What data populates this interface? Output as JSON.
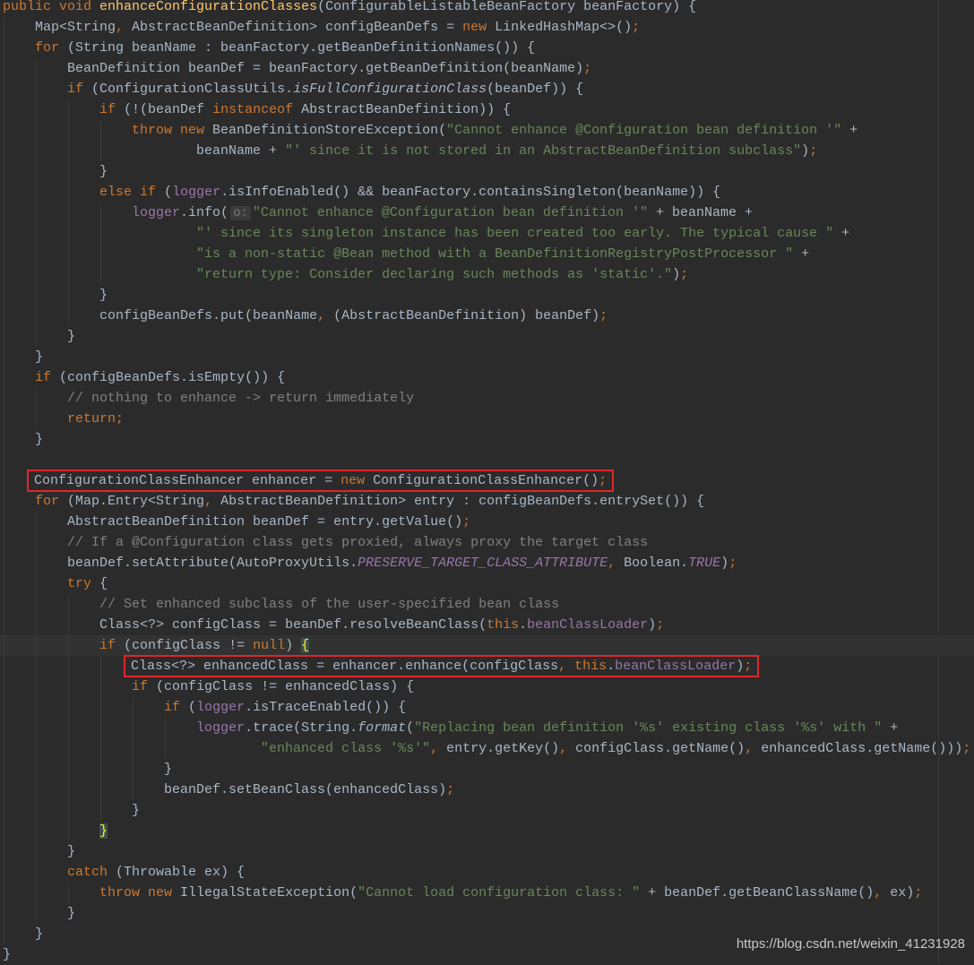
{
  "colors": {
    "background": "#2b2b2b",
    "text": "#a9b7c6",
    "keyword": "#cc7832",
    "string": "#6a8759",
    "comment": "#808080",
    "field": "#9876aa",
    "method_declaration": "#ffc66d",
    "highlight_box": "#e0262a"
  },
  "current_line": 32,
  "watermark": "https://blog.csdn.net/weixin_41231928",
  "lines": [
    {
      "indent": 0,
      "depth": 0,
      "tokens": [
        [
          "k",
          "public void "
        ],
        [
          "m",
          "enhanceConfigurationClasses"
        ],
        [
          "t",
          "(ConfigurableListableBeanFactory beanFactory) {"
        ]
      ]
    },
    {
      "indent": 4,
      "depth": 1,
      "tokens": [
        [
          "t",
          "Map<String, AbstractBeanDefinition> configBeanDefs = "
        ],
        [
          "k",
          "new"
        ],
        [
          "t",
          " LinkedHashMap<>();"
        ]
      ]
    },
    {
      "indent": 4,
      "depth": 1,
      "tokens": [
        [
          "k",
          "for"
        ],
        [
          "t",
          " (String beanName : beanFactory.getBeanDefinitionNames()) {"
        ]
      ]
    },
    {
      "indent": 8,
      "depth": 2,
      "tokens": [
        [
          "t",
          "BeanDefinition beanDef = beanFactory.getBeanDefinition(beanName);"
        ]
      ]
    },
    {
      "indent": 8,
      "depth": 2,
      "tokens": [
        [
          "k",
          "if"
        ],
        [
          "t",
          " (ConfigurationClassUtils."
        ],
        [
          "i",
          "isFullConfigurationClass"
        ],
        [
          "t",
          "(beanDef)) {"
        ]
      ]
    },
    {
      "indent": 12,
      "depth": 3,
      "tokens": [
        [
          "k",
          "if"
        ],
        [
          "t",
          " (!(beanDef "
        ],
        [
          "k",
          "instanceof"
        ],
        [
          "t",
          " AbstractBeanDefinition)) {"
        ]
      ]
    },
    {
      "indent": 16,
      "depth": 4,
      "tokens": [
        [
          "k",
          "throw new"
        ],
        [
          "t",
          " BeanDefinitionStoreException("
        ],
        [
          "s",
          "\"Cannot enhance @Configuration bean definition '\""
        ],
        [
          "t",
          " +"
        ]
      ]
    },
    {
      "indent": 24,
      "depth": 4,
      "tokens": [
        [
          "t",
          "beanName + "
        ],
        [
          "s",
          "\"' since it is not stored in an AbstractBeanDefinition subclass\""
        ],
        [
          "t",
          ");"
        ]
      ]
    },
    {
      "indent": 12,
      "depth": 3,
      "tokens": [
        [
          "t",
          "}"
        ]
      ]
    },
    {
      "indent": 12,
      "depth": 3,
      "tokens": [
        [
          "k",
          "else if"
        ],
        [
          "t",
          " ("
        ],
        [
          "f",
          "logger"
        ],
        [
          "t",
          ".isInfoEnabled() && beanFactory.containsSingleton(beanName)) {"
        ]
      ]
    },
    {
      "indent": 16,
      "depth": 4,
      "tokens": [
        [
          "f",
          "logger"
        ],
        [
          "t",
          ".info("
        ],
        [
          "h",
          "o:"
        ],
        [
          "s",
          "\"Cannot enhance @Configuration bean definition '\""
        ],
        [
          "t",
          " + beanName +"
        ]
      ]
    },
    {
      "indent": 24,
      "depth": 4,
      "tokens": [
        [
          "s",
          "\"' since its singleton instance has been created too early. The typical cause \""
        ],
        [
          "t",
          " +"
        ]
      ]
    },
    {
      "indent": 24,
      "depth": 4,
      "tokens": [
        [
          "s",
          "\"is a non-static @Bean method with a BeanDefinitionRegistryPostProcessor \""
        ],
        [
          "t",
          " +"
        ]
      ]
    },
    {
      "indent": 24,
      "depth": 4,
      "tokens": [
        [
          "s",
          "\"return type: Consider declaring such methods as 'static'.\""
        ],
        [
          "t",
          ");"
        ]
      ]
    },
    {
      "indent": 12,
      "depth": 3,
      "tokens": [
        [
          "t",
          "}"
        ]
      ]
    },
    {
      "indent": 12,
      "depth": 3,
      "tokens": [
        [
          "t",
          "configBeanDefs.put(beanName, (AbstractBeanDefinition) beanDef);"
        ]
      ]
    },
    {
      "indent": 8,
      "depth": 2,
      "tokens": [
        [
          "t",
          "}"
        ]
      ]
    },
    {
      "indent": 4,
      "depth": 1,
      "tokens": [
        [
          "t",
          "}"
        ]
      ]
    },
    {
      "indent": 4,
      "depth": 1,
      "tokens": [
        [
          "k",
          "if"
        ],
        [
          "t",
          " (configBeanDefs.isEmpty()) {"
        ]
      ]
    },
    {
      "indent": 8,
      "depth": 2,
      "tokens": [
        [
          "c",
          "// nothing to enhance -> return immediately"
        ]
      ]
    },
    {
      "indent": 8,
      "depth": 2,
      "tokens": [
        [
          "k",
          "return"
        ],
        [
          "t",
          ";"
        ]
      ]
    },
    {
      "indent": 4,
      "depth": 1,
      "tokens": [
        [
          "t",
          "}"
        ]
      ]
    },
    {
      "indent": 0,
      "depth": 1,
      "tokens": []
    },
    {
      "indent": 4,
      "depth": 1,
      "boxed": true,
      "tokens": [
        [
          "t",
          "ConfigurationClassEnhancer enhancer = "
        ],
        [
          "k",
          "new"
        ],
        [
          "t",
          " ConfigurationClassEnhancer();"
        ]
      ]
    },
    {
      "indent": 4,
      "depth": 1,
      "tokens": [
        [
          "k",
          "for"
        ],
        [
          "t",
          " (Map.Entry<String, AbstractBeanDefinition> entry : configBeanDefs.entrySet()) {"
        ]
      ]
    },
    {
      "indent": 8,
      "depth": 2,
      "tokens": [
        [
          "t",
          "AbstractBeanDefinition beanDef = entry.getValue();"
        ]
      ]
    },
    {
      "indent": 8,
      "depth": 2,
      "tokens": [
        [
          "c",
          "// If a @Configuration class gets proxied, always proxy the target class"
        ]
      ]
    },
    {
      "indent": 8,
      "depth": 2,
      "tokens": [
        [
          "t",
          "beanDef.setAttribute(AutoProxyUtils."
        ],
        [
          "fi",
          "PRESERVE_TARGET_CLASS_ATTRIBUTE"
        ],
        [
          "t",
          ", Boolean."
        ],
        [
          "fi",
          "TRUE"
        ],
        [
          "t",
          ");"
        ]
      ]
    },
    {
      "indent": 8,
      "depth": 2,
      "tokens": [
        [
          "k",
          "try"
        ],
        [
          "t",
          " {"
        ]
      ]
    },
    {
      "indent": 12,
      "depth": 3,
      "tokens": [
        [
          "c",
          "// Set enhanced subclass of the user-specified bean class"
        ]
      ]
    },
    {
      "indent": 12,
      "depth": 3,
      "tokens": [
        [
          "t",
          "Class<?> configClass = beanDef.resolveBeanClass("
        ],
        [
          "k",
          "this"
        ],
        [
          "t",
          "."
        ],
        [
          "f",
          "beanClassLoader"
        ],
        [
          "t",
          ");"
        ]
      ]
    },
    {
      "indent": 12,
      "depth": 3,
      "tokens": [
        [
          "k",
          "if"
        ],
        [
          "t",
          " (configClass != "
        ],
        [
          "k",
          "null"
        ],
        [
          "t",
          ") "
        ],
        [
          "b",
          "{"
        ]
      ]
    },
    {
      "indent": 16,
      "depth": 4,
      "boxed": true,
      "tokens": [
        [
          "t",
          "Class<?> enhancedClass = enhancer.enhance(configClass, "
        ],
        [
          "k",
          "this"
        ],
        [
          "t",
          "."
        ],
        [
          "f",
          "beanClassLoader"
        ],
        [
          "t",
          ");"
        ]
      ]
    },
    {
      "indent": 16,
      "depth": 4,
      "tokens": [
        [
          "k",
          "if"
        ],
        [
          "t",
          " (configClass != enhancedClass) {"
        ]
      ]
    },
    {
      "indent": 20,
      "depth": 5,
      "tokens": [
        [
          "k",
          "if"
        ],
        [
          "t",
          " ("
        ],
        [
          "f",
          "logger"
        ],
        [
          "t",
          ".isTraceEnabled()) {"
        ]
      ]
    },
    {
      "indent": 24,
      "depth": 6,
      "tokens": [
        [
          "f",
          "logger"
        ],
        [
          "t",
          ".trace(String."
        ],
        [
          "i",
          "format"
        ],
        [
          "t",
          "("
        ],
        [
          "s",
          "\"Replacing bean definition '%s' existing class '%s' with \""
        ],
        [
          "t",
          " +"
        ]
      ]
    },
    {
      "indent": 32,
      "depth": 6,
      "tokens": [
        [
          "s",
          "\"enhanced class '%s'\""
        ],
        [
          "t",
          ", entry.getKey(), configClass.getName(), enhancedClass.getName()));"
        ]
      ]
    },
    {
      "indent": 20,
      "depth": 5,
      "tokens": [
        [
          "t",
          "}"
        ]
      ]
    },
    {
      "indent": 20,
      "depth": 5,
      "tokens": [
        [
          "t",
          "beanDef.setBeanClass(enhancedClass);"
        ]
      ]
    },
    {
      "indent": 16,
      "depth": 4,
      "tokens": [
        [
          "t",
          "}"
        ]
      ]
    },
    {
      "indent": 12,
      "depth": 3,
      "tokens": [
        [
          "b",
          "}"
        ]
      ]
    },
    {
      "indent": 8,
      "depth": 2,
      "tokens": [
        [
          "t",
          "}"
        ]
      ]
    },
    {
      "indent": 8,
      "depth": 2,
      "tokens": [
        [
          "k",
          "catch"
        ],
        [
          "t",
          " (Throwable ex) {"
        ]
      ]
    },
    {
      "indent": 12,
      "depth": 3,
      "tokens": [
        [
          "k",
          "throw new"
        ],
        [
          "t",
          " IllegalStateException("
        ],
        [
          "s",
          "\"Cannot load configuration class: \""
        ],
        [
          "t",
          " + beanDef.getBeanClassName(), ex);"
        ]
      ]
    },
    {
      "indent": 8,
      "depth": 2,
      "tokens": [
        [
          "t",
          "}"
        ]
      ]
    },
    {
      "indent": 4,
      "depth": 1,
      "tokens": [
        [
          "t",
          "}"
        ]
      ]
    },
    {
      "indent": 0,
      "depth": 0,
      "tokens": [
        [
          "t",
          "}"
        ]
      ]
    }
  ]
}
